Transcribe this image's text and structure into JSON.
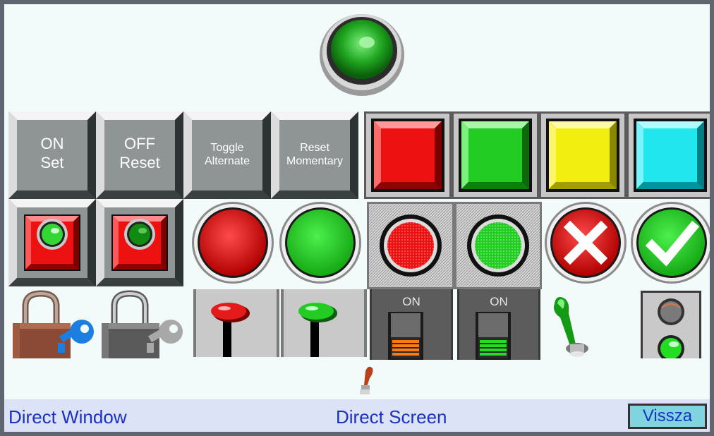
{
  "buttons": {
    "on_set": {
      "line1": "ON",
      "line2": "Set"
    },
    "off_reset": {
      "line1": "OFF",
      "line2": "Reset"
    },
    "toggle_alternate": {
      "line1": "Toggle",
      "line2": "Alternate"
    },
    "reset_momentary": {
      "line1": "Reset",
      "line2": "Momentary"
    }
  },
  "switches": {
    "orange_on_label": "ON",
    "green_on_label": "ON"
  },
  "bottom_bar": {
    "direct_window": "Direct Window",
    "direct_screen": "Direct Screen",
    "back_button": "Vissza"
  },
  "colors": {
    "red": "#ee1111",
    "green": "#22cc22",
    "yellow": "#f2ee10",
    "cyan": "#22e6ee",
    "gray_button": "#8f9494",
    "text_blue": "#1a31c4"
  },
  "icons": [
    "green-indicator-lamp-icon",
    "padlock-key-icon",
    "lever-switch-icon",
    "toggle-switch-icon",
    "close-x-icon",
    "checkmark-icon",
    "traffic-light-icon"
  ]
}
